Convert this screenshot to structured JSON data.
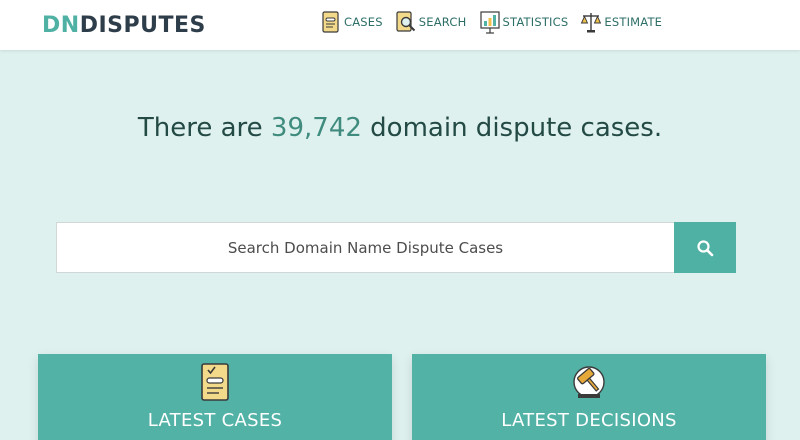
{
  "header": {
    "logo_part1": "DN",
    "logo_part2": "DISPUTES",
    "nav": [
      {
        "label": "CASES",
        "icon": "cases-document-icon"
      },
      {
        "label": "SEARCH",
        "icon": "search-document-icon"
      },
      {
        "label": "STATISTICS",
        "icon": "statistics-chart-icon"
      },
      {
        "label": "ESTIMATE",
        "icon": "scales-icon"
      }
    ]
  },
  "hero": {
    "prefix": "There are ",
    "count": "39,742",
    "suffix": " domain dispute cases."
  },
  "search": {
    "placeholder": "Search Domain Name Dispute Cases",
    "button_icon": "magnifier-icon"
  },
  "cards": [
    {
      "title": "LATEST CASES",
      "icon": "checklist-document-icon"
    },
    {
      "title": "LATEST DECISIONS",
      "icon": "gavel-icon"
    }
  ],
  "colors": {
    "accent": "#4fb0a4",
    "background": "#dff1ef",
    "heading": "#234a45",
    "count": "#3f8c7e",
    "logo_dark": "#2e3d4a"
  }
}
